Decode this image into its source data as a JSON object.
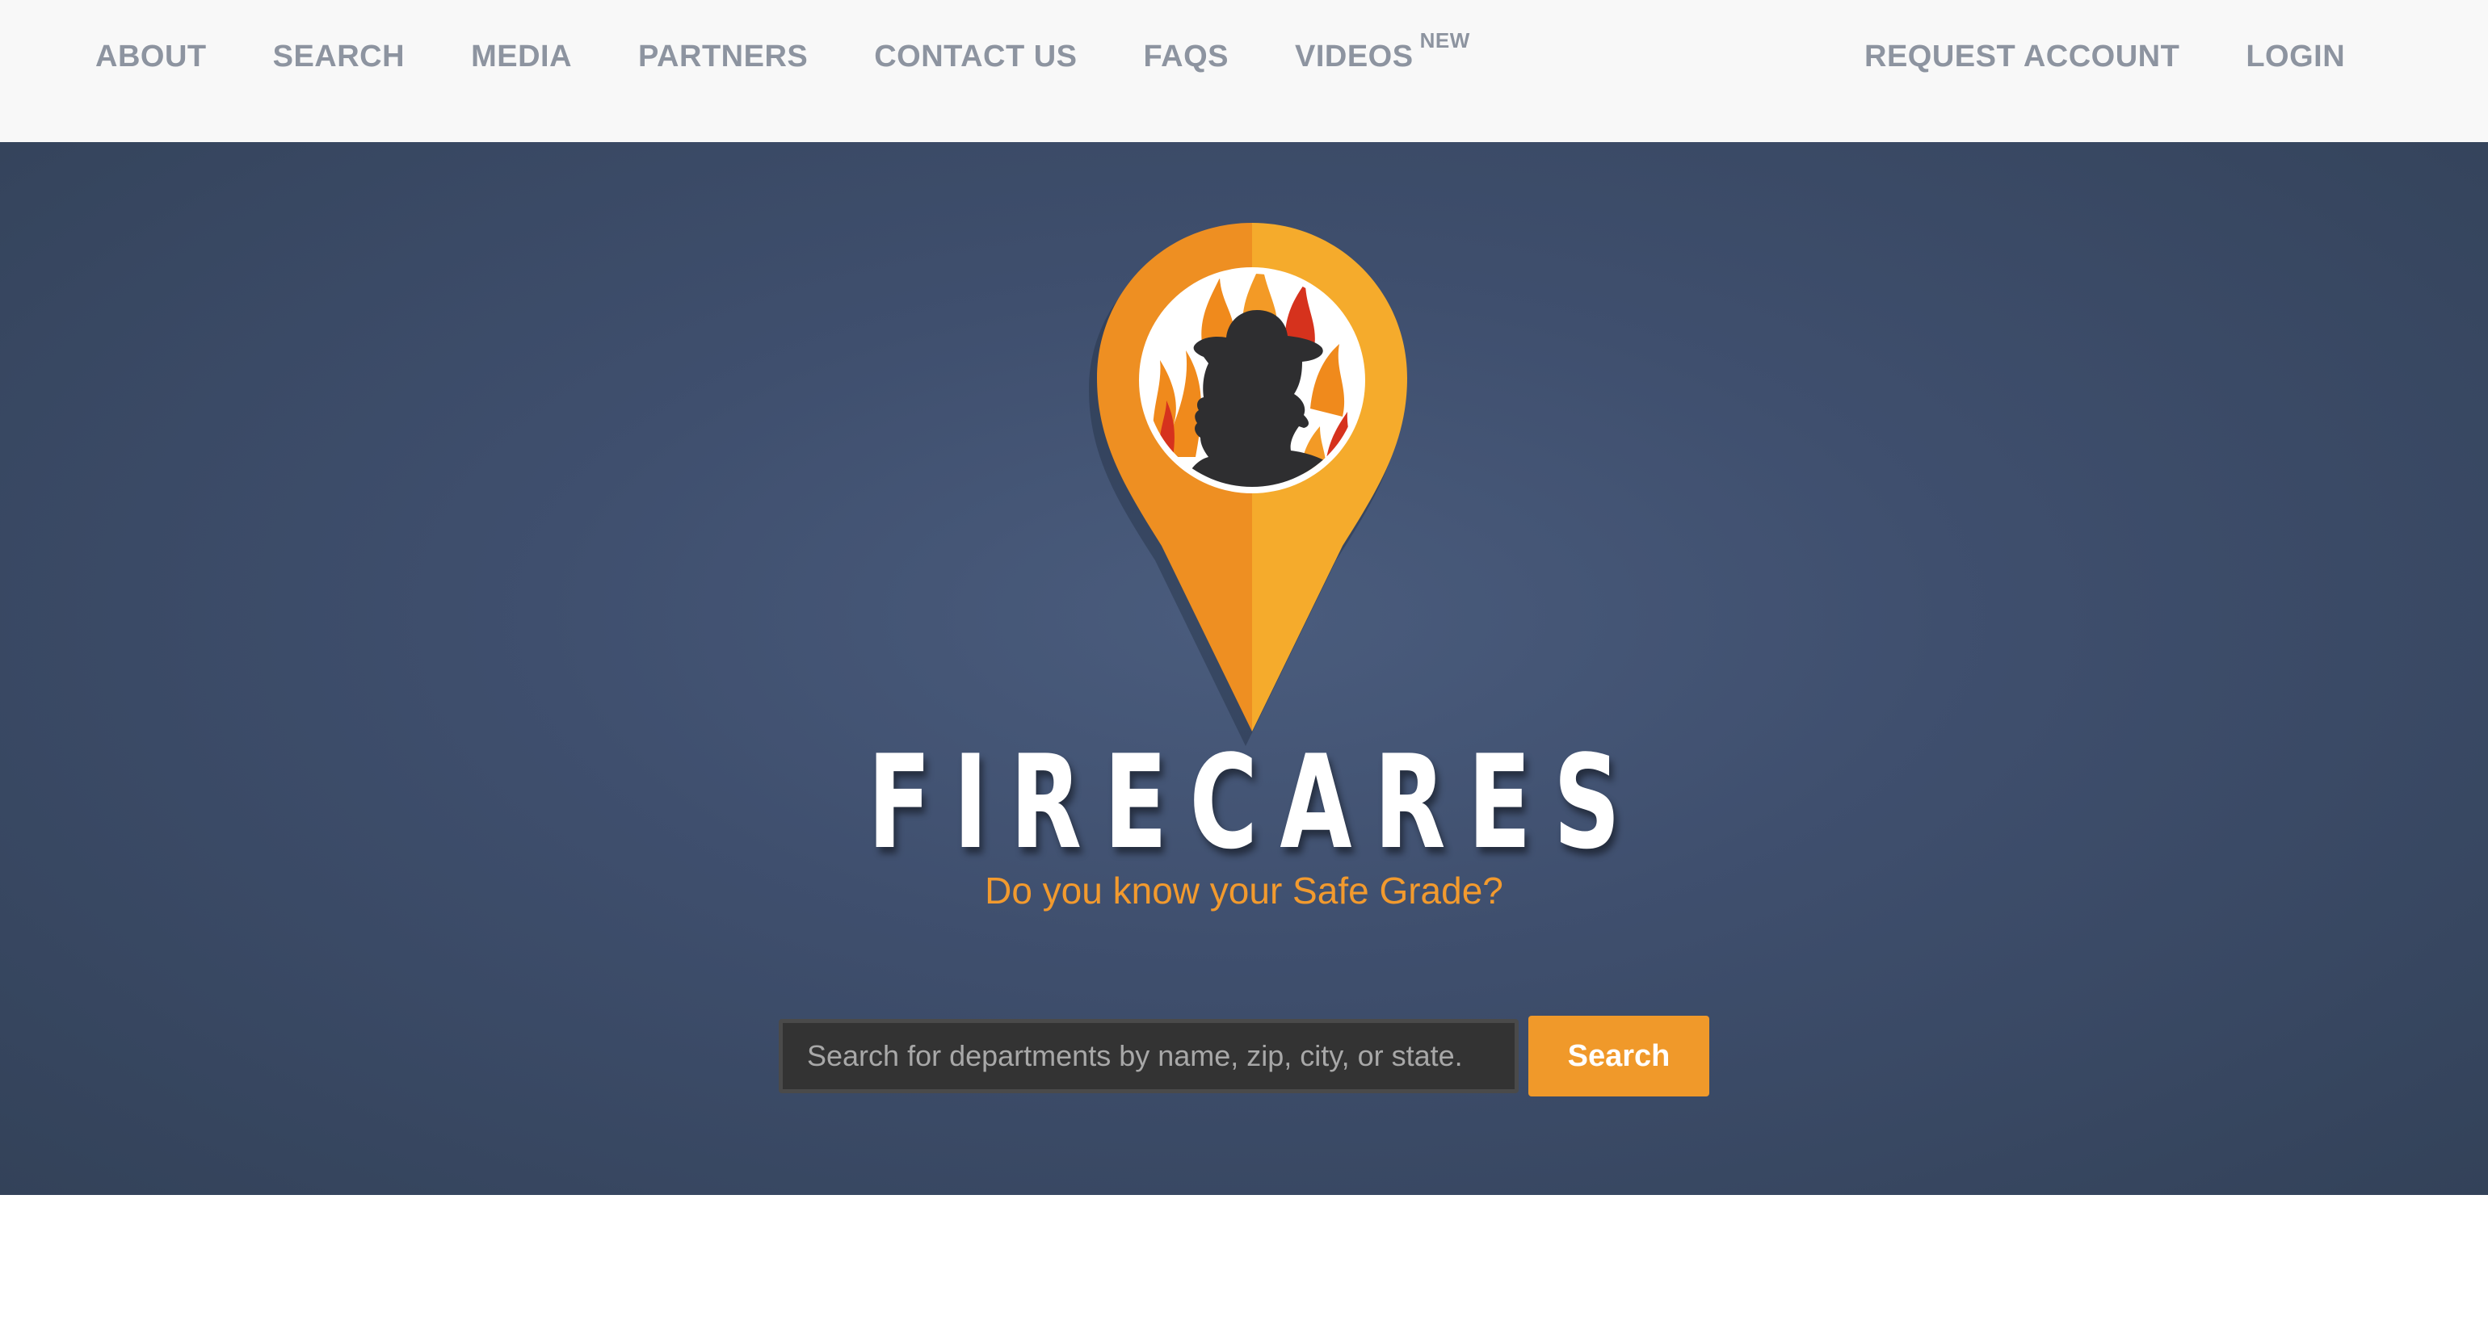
{
  "nav": {
    "left_items": [
      {
        "label": "ABOUT"
      },
      {
        "label": "SEARCH"
      },
      {
        "label": "MEDIA"
      },
      {
        "label": "PARTNERS"
      },
      {
        "label": "CONTACT US"
      },
      {
        "label": "FAQS"
      },
      {
        "label": "VIDEOS",
        "badge": "NEW"
      }
    ],
    "right_items": [
      {
        "label": "REQUEST ACCOUNT"
      },
      {
        "label": "LOGIN"
      }
    ]
  },
  "hero": {
    "brand": "FIRECARES",
    "tagline": "Do you know your Safe Grade?",
    "logo_icon": "map-pin-firefighter-flame-icon",
    "search": {
      "placeholder": "Search for departments by name, zip, city, or state.",
      "value": "",
      "button_label": "Search"
    }
  },
  "colors": {
    "nav_background": "#f8f8f8",
    "nav_text": "#8d94a0",
    "hero_background": "#3f4f6e",
    "accent_orange": "#f0992a",
    "input_background": "#333333"
  }
}
